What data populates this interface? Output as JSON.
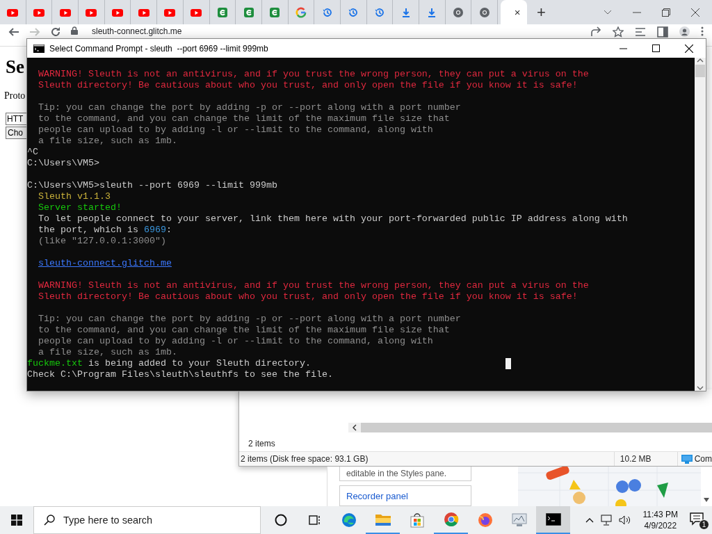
{
  "browser": {
    "tabs": [
      {
        "kind": "youtube",
        "selected": false
      },
      {
        "kind": "youtube",
        "selected": false
      },
      {
        "kind": "youtube",
        "selected": false
      },
      {
        "kind": "youtube",
        "selected": false
      },
      {
        "kind": "youtube",
        "selected": false
      },
      {
        "kind": "youtube",
        "selected": false
      },
      {
        "kind": "youtube",
        "selected": false
      },
      {
        "kind": "youtube",
        "selected": false
      },
      {
        "kind": "sheet",
        "selected": false
      },
      {
        "kind": "sheet",
        "selected": false
      },
      {
        "kind": "sheet",
        "selected": false
      },
      {
        "kind": "google",
        "selected": false
      },
      {
        "kind": "history",
        "selected": false
      },
      {
        "kind": "history",
        "selected": false
      },
      {
        "kind": "history",
        "selected": false
      },
      {
        "kind": "download",
        "selected": false
      },
      {
        "kind": "download",
        "selected": false
      },
      {
        "kind": "globe",
        "selected": false
      },
      {
        "kind": "globe",
        "selected": false
      },
      {
        "kind": "blank",
        "selected": true,
        "close": "×"
      }
    ],
    "new_tab": "+",
    "address": "sleuth-connect.glitch.me"
  },
  "page": {
    "heading": "Se",
    "label": "Proto",
    "select": "HTT",
    "button": "Cho"
  },
  "cmd": {
    "title": "Select Command Prompt - sleuth  --port 6969 --limit 999mb",
    "lines": [
      {
        "indent": true,
        "space_before": false,
        "segments": [
          {
            "kind": "error",
            "text": "WARNING! Sleuth is not an antivirus, and if you trust the wrong person, they can put a virus on the"
          }
        ]
      },
      {
        "indent": true,
        "space_before": false,
        "segments": [
          {
            "kind": "error",
            "text": "Sleuth directory! Be cautious about who you trust, and only open the file if you know it is safe!"
          }
        ]
      },
      {
        "indent": true,
        "space_before": true,
        "segments": [
          {
            "kind": "tip",
            "text": "Tip: you can change the port by adding -p or --port along with a port number"
          }
        ]
      },
      {
        "indent": true,
        "space_before": false,
        "segments": [
          {
            "kind": "tip",
            "text": "to the command, and you can change the limit of the maximum file size that"
          }
        ]
      },
      {
        "indent": true,
        "space_before": false,
        "segments": [
          {
            "kind": "tip",
            "text": "people can upload to by adding -l or --limit to the command, along with"
          }
        ]
      },
      {
        "indent": true,
        "space_before": false,
        "segments": [
          {
            "kind": "tip",
            "text": "a file size, such as 1mb."
          }
        ]
      },
      {
        "indent": false,
        "space_before": false,
        "segments": [
          {
            "kind": "plain",
            "text": "^C"
          }
        ]
      },
      {
        "indent": false,
        "space_before": false,
        "segments": [
          {
            "kind": "plain",
            "text": "C:\\Users\\VM5>"
          }
        ]
      },
      {
        "indent": false,
        "space_before": true,
        "segments": [
          {
            "kind": "plain",
            "text": "C:\\Users\\VM5>sleuth --port 6969 --limit 999mb"
          }
        ]
      },
      {
        "indent": true,
        "space_before": false,
        "segments": [
          {
            "kind": "version",
            "text": "Sleuth v1.1.3"
          }
        ]
      },
      {
        "indent": true,
        "space_before": false,
        "segments": [
          {
            "kind": "success",
            "text": "Server started!"
          }
        ]
      },
      {
        "indent": true,
        "space_before": false,
        "segments": [
          {
            "kind": "plain",
            "text": "To let people connect to your server, link them here with your port-forwarded public IP address along with"
          }
        ]
      },
      {
        "indent": true,
        "space_before": false,
        "segments": [
          {
            "kind": "plain",
            "text": "the port, which is "
          },
          {
            "kind": "number",
            "text": "6969"
          },
          {
            "kind": "plain",
            "text": ":"
          }
        ]
      },
      {
        "indent": true,
        "space_before": false,
        "segments": [
          {
            "kind": "tip",
            "text": "(like \"127.0.0.1:3000\")"
          }
        ]
      },
      {
        "indent": true,
        "space_before": true,
        "segments": [
          {
            "kind": "link",
            "text": "sleuth-connect.glitch.me"
          }
        ]
      },
      {
        "indent": true,
        "space_before": true,
        "segments": [
          {
            "kind": "error",
            "text": "WARNING! Sleuth is not an antivirus, and if you trust the wrong person, they can put a virus on the"
          }
        ]
      },
      {
        "indent": true,
        "space_before": false,
        "segments": [
          {
            "kind": "error",
            "text": "Sleuth directory! Be cautious about who you trust, and only open the file if you know it is safe!"
          }
        ]
      },
      {
        "indent": true,
        "space_before": true,
        "segments": [
          {
            "kind": "tip",
            "text": "Tip: you can change the port by adding -p or --port along with a port number"
          }
        ]
      },
      {
        "indent": true,
        "space_before": false,
        "segments": [
          {
            "kind": "tip",
            "text": "to the command, and you can change the limit of the maximum file size that"
          }
        ]
      },
      {
        "indent": true,
        "space_before": false,
        "segments": [
          {
            "kind": "tip",
            "text": "people can upload to by adding -l or --limit to the command, along with"
          }
        ]
      },
      {
        "indent": true,
        "space_before": false,
        "segments": [
          {
            "kind": "tip",
            "text": "a file size, such as 1mb."
          }
        ]
      },
      {
        "indent": false,
        "space_before": false,
        "segments": [
          {
            "kind": "success",
            "text": "fuckme.txt"
          },
          {
            "kind": "plain",
            "text": " is being added to your Sleuth directory."
          }
        ]
      },
      {
        "indent": false,
        "space_before": false,
        "segments": [
          {
            "kind": "plain",
            "text": "Check C:\\Program Files\\sleuth\\sleuthfs to see the file."
          }
        ]
      }
    ]
  },
  "explorer": {
    "item_count": "2 items",
    "status": "2 items (Disk free space: 93.1 GB)",
    "size": "10.2 MB",
    "location": "Com"
  },
  "devtools": {
    "tip": "editable in the Styles pane.",
    "link": "Recorder panel"
  },
  "taskbar": {
    "search_placeholder": "Type here to search",
    "apps": [
      {
        "kind": "cortana",
        "selected": false,
        "running": false
      },
      {
        "kind": "taskview",
        "selected": false,
        "running": false
      },
      {
        "kind": "edge",
        "selected": false,
        "running": false
      },
      {
        "kind": "folder",
        "selected": false,
        "running": true
      },
      {
        "kind": "store",
        "selected": false,
        "running": false
      },
      {
        "kind": "chrome",
        "selected": false,
        "running": true
      },
      {
        "kind": "firefox",
        "selected": false,
        "running": false
      },
      {
        "kind": "monitor",
        "selected": false,
        "running": false
      },
      {
        "kind": "terminal",
        "selected": true,
        "running": true
      }
    ],
    "time": "11:43 PM",
    "date": "4/9/2022",
    "notifications": "1"
  }
}
